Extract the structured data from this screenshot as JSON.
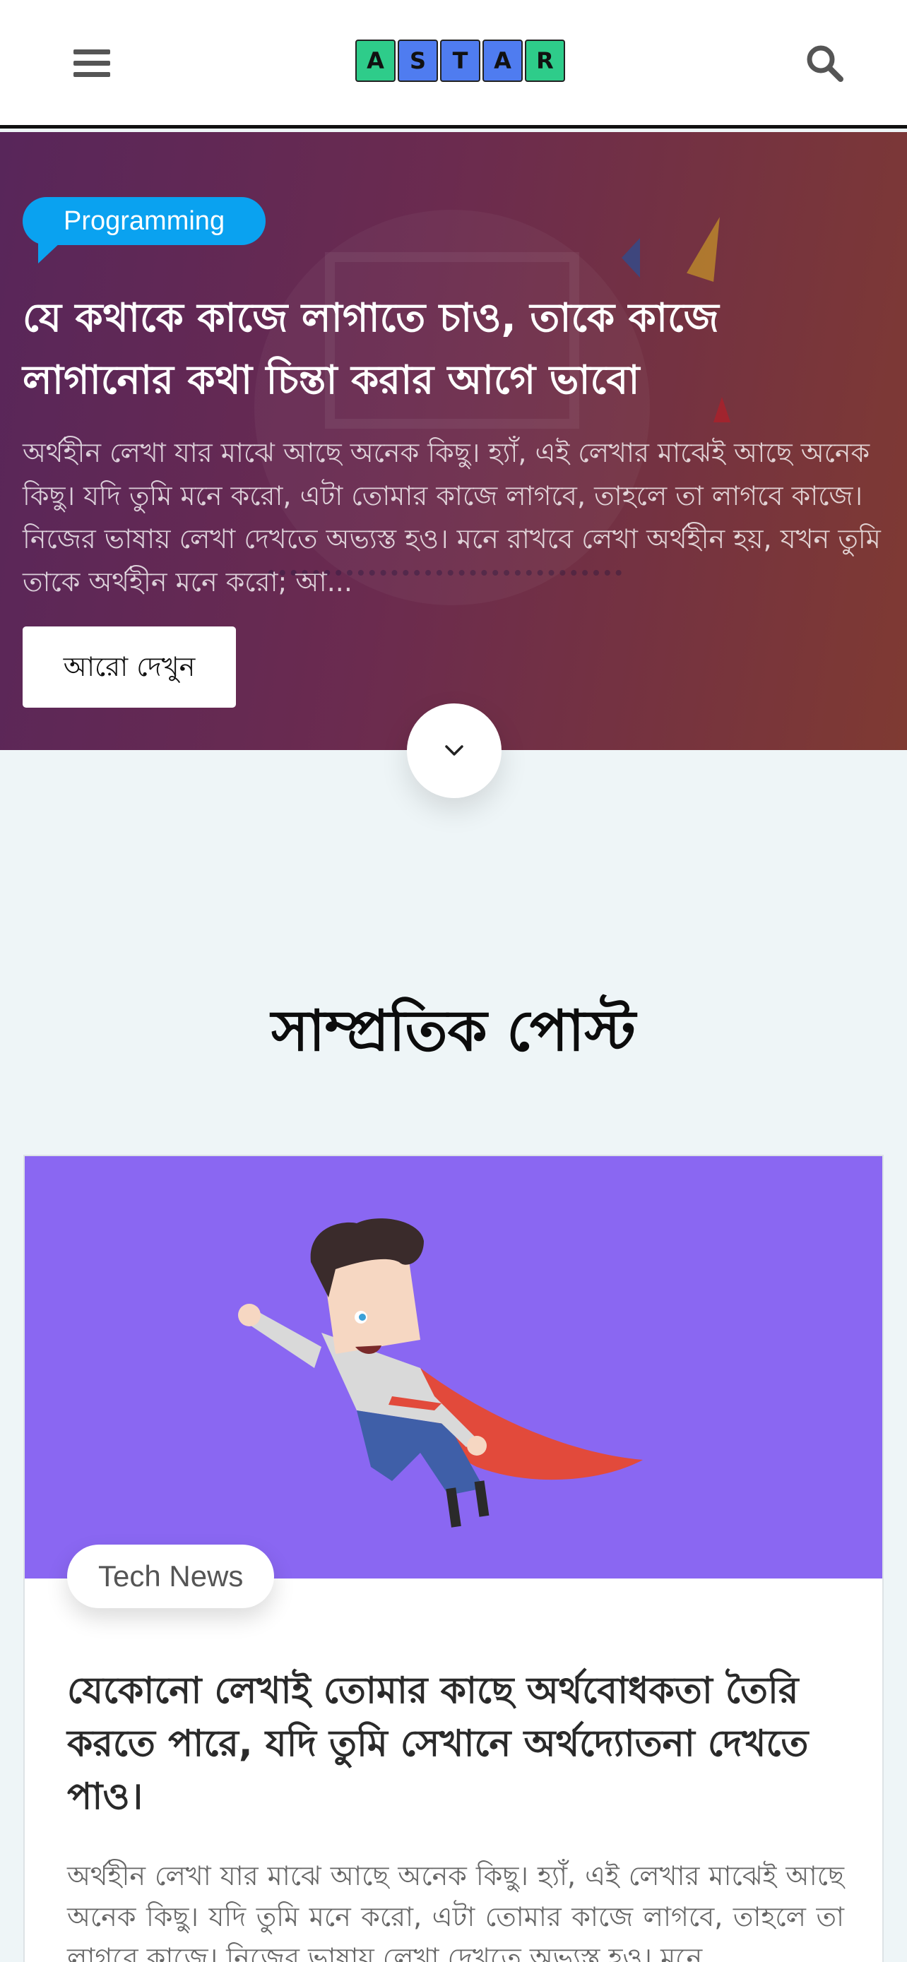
{
  "header": {
    "logo_letters": [
      "A",
      "S",
      "T",
      "A",
      "R"
    ],
    "logo_colors": [
      "#2ecc8a",
      "#4f7cf0",
      "#4f7cf0",
      "#4f7cf0",
      "#2ecc8a"
    ],
    "menu_icon": "hamburger-icon",
    "search_icon": "search-icon"
  },
  "hero": {
    "category": "Programming",
    "title": "যে কথাকে কাজে লাগাতে চাও, তাকে কাজে লাগানোর কথা চিন্তা করার আগে ভাবো",
    "excerpt": "অর্থহীন লেখা যার মাঝে আছে অনেক কিছু। হ্যাঁ, এই লেখার মাঝেই আছে অনেক কিছু। যদি তুমি মনে করো, এটা তোমার কাজে লাগবে, তাহলে তা লাগবে কাজে। নিজের ভাষায় লেখা দেখতে অভ্যস্ত হও। মনে রাখবে লেখা অর্থহীন হয়, যখন তুমি তাকে অর্থহীন মনে করো; আ...",
    "button_label": "আরো দেখুন",
    "scroll_icon": "chevron-down-icon",
    "badge_color": "#0aa2f0"
  },
  "recent": {
    "section_title": "সাম্প্রতিক পোস্ট",
    "posts": [
      {
        "category": "Tech News",
        "title": "যেকোনো লেখাই তোমার কাছে অর্থবোধকতা তৈরি করতে পারে, যদি তুমি সেখানে অর্থদ্যোতনা দেখতে পাও।",
        "excerpt": "অর্থহীন লেখা যার মাঝে আছে অনেক কিছু। হ্যাঁ, এই লেখার মাঝেই আছে অনেক কিছু। যদি তুমি মনে করো, এটা তোমার কাজে লাগবে, তাহলে তা লাগবে কাজে। নিজের ভাষায় লেখা দেখতে অভ্যস্ত হও। মনে",
        "image_bg": "#8a67f2"
      }
    ]
  }
}
